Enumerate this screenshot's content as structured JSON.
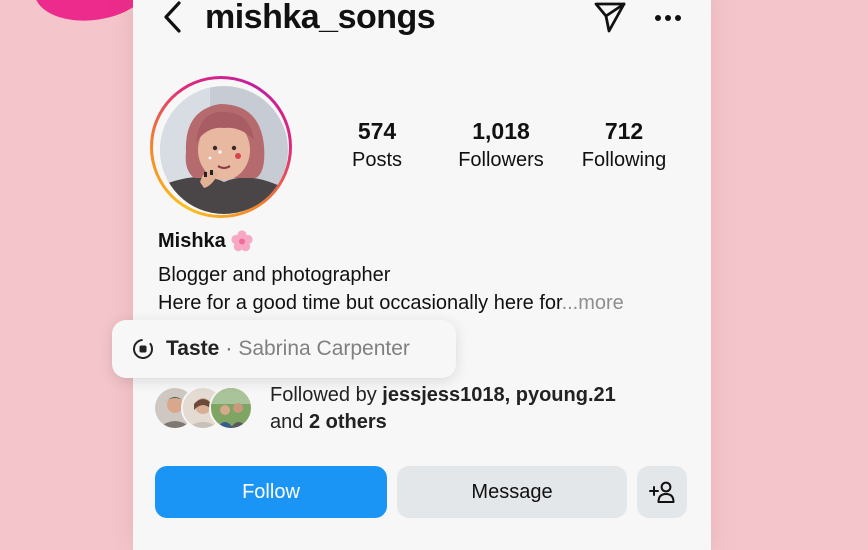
{
  "profile": {
    "username": "mishka_songs",
    "display_name": "Mishka",
    "name_emoji_icon": "cherry-blossom-icon",
    "stats": {
      "posts": {
        "count": "574",
        "label": "Posts"
      },
      "followers": {
        "count": "1,018",
        "label": "Followers"
      },
      "following": {
        "count": "712",
        "label": "Following"
      }
    },
    "bio": {
      "line1": "Blogger and photographer",
      "line2": "Here for a good time but occasionally here for",
      "more": "...more"
    }
  },
  "taste": {
    "label": "Taste",
    "separator": "·",
    "artist": "Sabrina Carpenter"
  },
  "followed_by": {
    "prefix": "Followed by ",
    "users": "jessjess1018, pyoung.21",
    "line2_prefix": "and ",
    "others": "2 others"
  },
  "actions": {
    "follow": "Follow",
    "message": "Message"
  },
  "colors": {
    "background": "#f4c6cb",
    "follow_button": "#1b95f5",
    "secondary_button": "#e4e7ea",
    "muted_text": "#8e8e8e"
  }
}
